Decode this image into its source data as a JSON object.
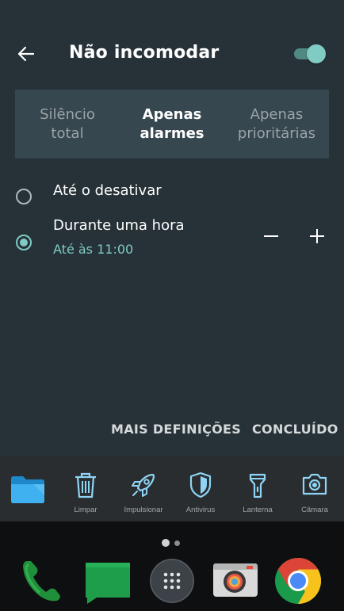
{
  "header": {
    "title": "Não incomodar",
    "toggle_on": true
  },
  "tabs": [
    {
      "label": "Silêncio\ntotal",
      "active": false
    },
    {
      "label": "Apenas\nalarmes",
      "active": true
    },
    {
      "label": "Apenas\nprioritárias",
      "active": false
    }
  ],
  "options": [
    {
      "label": "Até o desativar",
      "selected": false
    },
    {
      "label": "Durante uma hora",
      "sublabel": "Até às 11:00",
      "selected": true
    }
  ],
  "actions": {
    "more_settings": "MAIS DEFINIÇÕES",
    "done": "CONCLUÍDO"
  },
  "toolbar": [
    {
      "icon": "folder-icon",
      "label": ""
    },
    {
      "icon": "trash-icon",
      "label": "Limpar"
    },
    {
      "icon": "rocket-icon",
      "label": "Impulsionar"
    },
    {
      "icon": "shield-icon",
      "label": "Antivirus"
    },
    {
      "icon": "flashlight-icon",
      "label": "Lanterna"
    },
    {
      "icon": "camera-icon",
      "label": "Câmara"
    }
  ],
  "dock": [
    "phone-icon",
    "messages-icon",
    "app-drawer-icon",
    "camera-app-icon",
    "chrome-icon"
  ],
  "colors": {
    "accent": "#80cbc4",
    "panel": "#263238",
    "tabs_bg": "#37474f"
  }
}
